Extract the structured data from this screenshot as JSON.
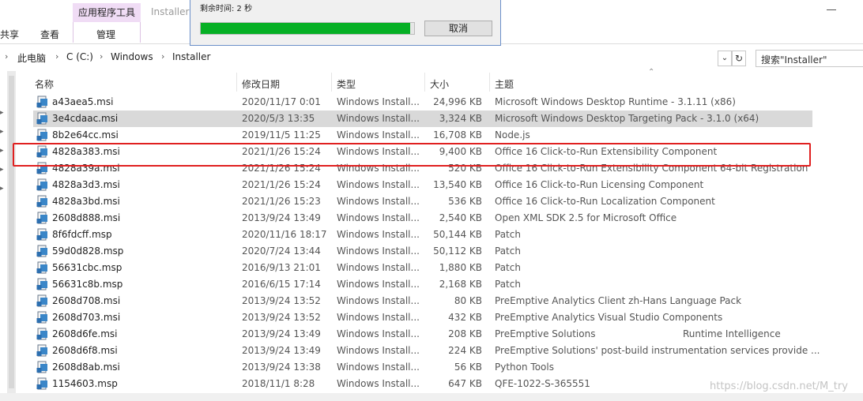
{
  "ribbon": {
    "context_tab": "应用程序工具",
    "window_title": "Installer",
    "tab_share": "共享",
    "tab_view": "查看",
    "tab_manage": "管理"
  },
  "address": {
    "crumbs": [
      "此电脑",
      "C (C:)",
      "Windows",
      "Installer"
    ],
    "search_placeholder": "搜索\"Installer\""
  },
  "columns": {
    "name": "名称",
    "date": "修改日期",
    "type": "类型",
    "size": "大小",
    "subject": "主题"
  },
  "files": [
    {
      "name": "a43aea5.msi",
      "date": "2020/11/17 0:01",
      "type": "Windows Install...",
      "size": "24,996 KB",
      "subject": "Microsoft Windows Desktop Runtime - 3.1.11 (x86)"
    },
    {
      "name": "3e4cdaac.msi",
      "date": "2020/5/3 13:35",
      "type": "Windows Install...",
      "size": "3,324 KB",
      "subject": "Microsoft Windows Desktop Targeting Pack - 3.1.0 (x64)"
    },
    {
      "name": "8b2e64cc.msi",
      "date": "2019/11/5 11:25",
      "type": "Windows Install...",
      "size": "16,708 KB",
      "subject": "Node.js"
    },
    {
      "name": "4828a383.msi",
      "date": "2021/1/26 15:24",
      "type": "Windows Install...",
      "size": "9,400 KB",
      "subject": "Office 16 Click-to-Run Extensibility Component"
    },
    {
      "name": "4828a39a.msi",
      "date": "2021/1/26 15:24",
      "type": "Windows Install...",
      "size": "520 KB",
      "subject": "Office 16 Click-to-Run Extensibility Component 64-bit Registration"
    },
    {
      "name": "4828a3d3.msi",
      "date": "2021/1/26 15:24",
      "type": "Windows Install...",
      "size": "13,540 KB",
      "subject": "Office 16 Click-to-Run Licensing Component"
    },
    {
      "name": "4828a3bd.msi",
      "date": "2021/1/26 15:23",
      "type": "Windows Install...",
      "size": "536 KB",
      "subject": "Office 16 Click-to-Run Localization Component"
    },
    {
      "name": "2608d888.msi",
      "date": "2013/9/24 13:49",
      "type": "Windows Install...",
      "size": "2,540 KB",
      "subject": "Open XML SDK 2.5 for Microsoft Office"
    },
    {
      "name": "8f6fdcff.msp",
      "date": "2020/11/16 18:17",
      "type": "Windows Install...",
      "size": "50,144 KB",
      "subject": "Patch"
    },
    {
      "name": "59d0d828.msp",
      "date": "2020/7/24 13:44",
      "type": "Windows Install...",
      "size": "50,112 KB",
      "subject": "Patch"
    },
    {
      "name": "56631cbc.msp",
      "date": "2016/9/13 21:01",
      "type": "Windows Install...",
      "size": "1,880 KB",
      "subject": "Patch"
    },
    {
      "name": "56631c8b.msp",
      "date": "2016/6/15 17:14",
      "type": "Windows Install...",
      "size": "2,168 KB",
      "subject": "Patch"
    },
    {
      "name": "2608d708.msi",
      "date": "2013/9/24 13:52",
      "type": "Windows Install...",
      "size": "80 KB",
      "subject": "PreEmptive Analytics Client zh-Hans Language Pack"
    },
    {
      "name": "2608d703.msi",
      "date": "2013/9/24 13:52",
      "type": "Windows Install...",
      "size": "432 KB",
      "subject": "PreEmptive Analytics Visual Studio Components"
    },
    {
      "name": "2608d6fe.msi",
      "date": "2013/9/24 13:49",
      "type": "Windows Install...",
      "size": "208 KB",
      "subject": "PreEmptive Solutions",
      "extra": "Runtime Intelligence"
    },
    {
      "name": "2608d6f8.msi",
      "date": "2013/9/24 13:49",
      "type": "Windows Install...",
      "size": "224 KB",
      "subject": "PreEmptive Solutions' post-build instrumentation services provide ..."
    },
    {
      "name": "2608d8ab.msi",
      "date": "2013/9/24 13:38",
      "type": "Windows Install...",
      "size": "56 KB",
      "subject": "Python Tools"
    },
    {
      "name": "1154603.msp",
      "date": "2018/11/1 8:28",
      "type": "Windows Install...",
      "size": "647 KB",
      "subject": "QFE-1022-S-365551"
    }
  ],
  "dialog": {
    "remaining": "剩余时间: 2 秒",
    "cancel_label": "取消",
    "progress": 0.98
  },
  "watermark": "https://blog.csdn.net/M_try"
}
